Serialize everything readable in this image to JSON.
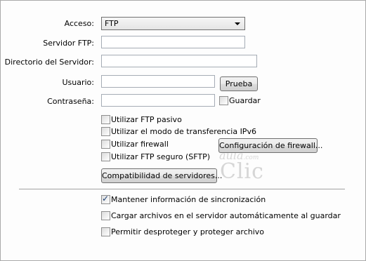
{
  "form": {
    "access_label": "Acceso:",
    "access_value": "FTP",
    "server_label": "Servidor FTP:",
    "server_value": "",
    "dir_label": "Directorio del Servidor:",
    "dir_value": "",
    "user_label": "Usuario:",
    "user_value": "",
    "test_button": "Prueba",
    "password_label": "Contraseña:",
    "password_value": "",
    "save_label": "Guardar"
  },
  "options": [
    {
      "label": "Utilizar FTP pasivo",
      "checked": false
    },
    {
      "label": "Utilizar el modo de transferencia IPv6",
      "checked": false
    },
    {
      "label": "Utilizar firewall",
      "checked": false
    },
    {
      "label": "Utilizar FTP seguro (SFTP)",
      "checked": false
    }
  ],
  "firewall_button": "Configuración de firewall...",
  "compat_button": "Compatibilidad de servidores...",
  "sync_options": [
    {
      "label": "Mantener información de sincronización",
      "checked": true
    },
    {
      "label": "Cargar archivos en el servidor automáticamente al guardar",
      "checked": false
    },
    {
      "label": "Permitir desproteger y proteger archivo",
      "checked": false
    }
  ],
  "watermark": {
    "line1": "aula",
    "line2": "Clic",
    "domain": ".com"
  }
}
